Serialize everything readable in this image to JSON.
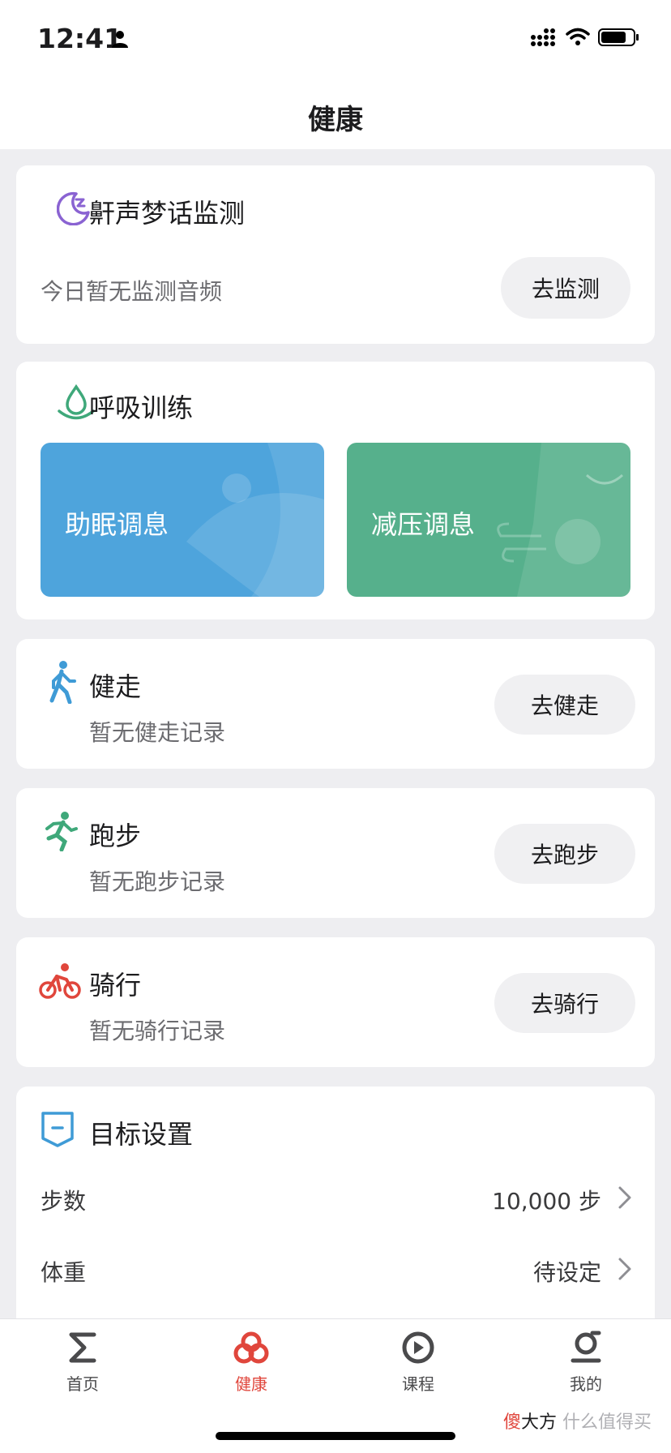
{
  "status_bar": {
    "time": "12:41"
  },
  "header": {
    "title": "健康"
  },
  "snore": {
    "title": "鼾声梦话监测",
    "status": "今日暂无监测音频",
    "button": "去监测"
  },
  "breathing": {
    "title": "呼吸训练",
    "tiles": [
      {
        "label": "助眠调息",
        "color": "#4ea4dc"
      },
      {
        "label": "减压调息",
        "color": "#56b08c"
      }
    ]
  },
  "activities": [
    {
      "title": "健走",
      "subtitle": "暂无健走记录",
      "button": "去健走",
      "icon": "walking-icon",
      "color": "#3f9bd6"
    },
    {
      "title": "跑步",
      "subtitle": "暂无跑步记录",
      "button": "去跑步",
      "icon": "running-icon",
      "color": "#3fa87a"
    },
    {
      "title": "骑行",
      "subtitle": "暂无骑行记录",
      "button": "去骑行",
      "icon": "cycling-icon",
      "color": "#e0463c"
    }
  ],
  "goals": {
    "title": "目标设置",
    "rows": [
      {
        "label": "步数",
        "value": "10,000 步"
      },
      {
        "label": "体重",
        "value": "待设定"
      }
    ]
  },
  "tab_bar": {
    "tabs": [
      {
        "label": "首页",
        "icon": "sigma-icon",
        "active": false
      },
      {
        "label": "健康",
        "icon": "health-rings-icon",
        "active": true
      },
      {
        "label": "课程",
        "icon": "play-circle-icon",
        "active": false
      },
      {
        "label": "我的",
        "icon": "profile-icon",
        "active": false
      }
    ],
    "active_color": "#e0463c"
  },
  "watermark": {
    "mark": "傻",
    "brand": "大方",
    "site": "什么值得买"
  }
}
